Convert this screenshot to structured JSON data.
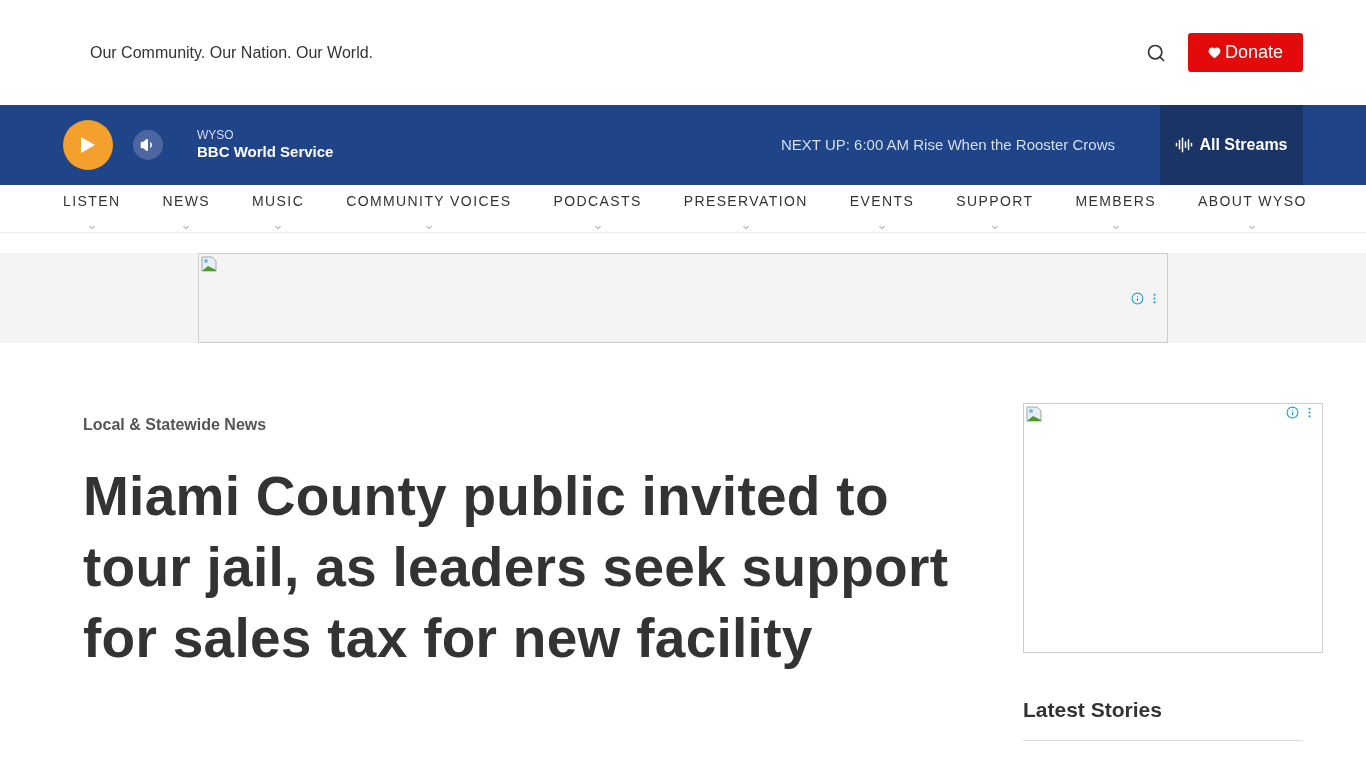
{
  "header": {
    "tagline": "Our Community. Our Nation. Our World.",
    "donate": "Donate"
  },
  "player": {
    "station": "WYSO",
    "program": "BBC World Service",
    "next_up": "NEXT UP: 6:00 AM Rise When the Rooster Crows",
    "all_streams": "All Streams"
  },
  "nav": [
    "LISTEN",
    "NEWS",
    "MUSIC",
    "COMMUNITY VOICES",
    "PODCASTS",
    "PRESERVATION",
    "EVENTS",
    "SUPPORT",
    "MEMBERS",
    "ABOUT WYSO"
  ],
  "article": {
    "category": "Local & Statewide News",
    "headline": "Miami County public invited to tour jail, as leaders seek support for sales tax for new facility"
  },
  "sidebar": {
    "heading": "Latest Stories"
  }
}
